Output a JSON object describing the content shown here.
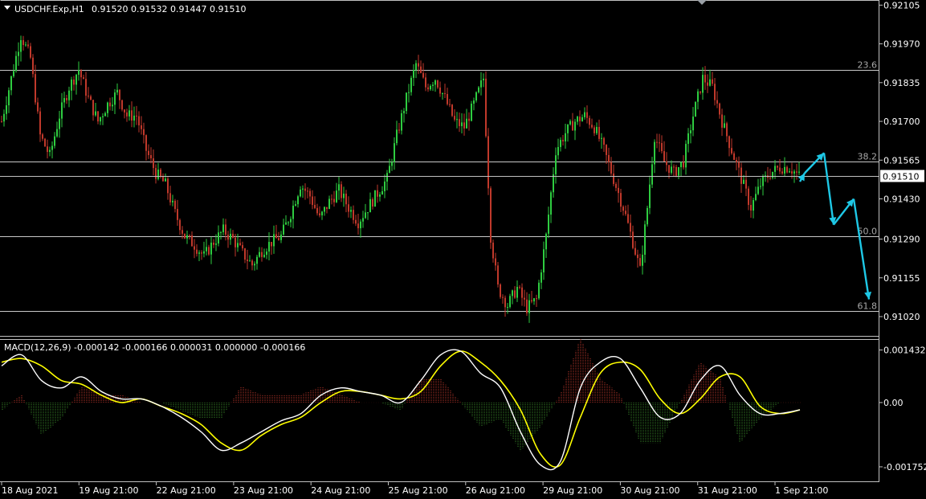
{
  "header": {
    "symbol": "USDCHF.Exp,H1",
    "ohlc": "0.91520 0.91532 0.91447 0.91510"
  },
  "colors": {
    "background": "#000000",
    "bull": "#2ecc40",
    "bear": "#c0392b",
    "grid": "#c0c0c0",
    "text": "#ffffff",
    "fib_label": "#a8a8a8",
    "signal_line": "#ffff00",
    "macd_line": "#ffffff",
    "projection": "#1ec8e6",
    "price_tag_bg": "#ffffff",
    "price_tag_text": "#000000"
  },
  "chart_data": [
    {
      "type": "candlestick",
      "title": "USDCHF.Exp,H1",
      "y_range": [
        0.9095,
        0.9212
      ],
      "y_ticks": [
        "0.92105",
        "0.91970",
        "0.91835",
        "0.91700",
        "0.91565",
        "0.91430",
        "0.91290",
        "0.91155",
        "0.91020"
      ],
      "current_price": "0.91510",
      "fibonacci_levels": [
        {
          "label": "23.6",
          "price": 0.9188
        },
        {
          "label": "38.2",
          "price": 0.9156
        },
        {
          "label": "50.0",
          "price": 0.913
        },
        {
          "label": "61.8",
          "price": 0.9104
        }
      ],
      "x_labels": [
        "18 Aug 2021",
        "19 Aug 21:00",
        "22 Aug 21:00",
        "23 Aug 21:00",
        "24 Aug 21:00",
        "25 Aug 21:00",
        "26 Aug 21:00",
        "29 Aug 21:00",
        "30 Aug 21:00",
        "31 Aug 21:00",
        "1 Sep 21:00"
      ],
      "close_path": [
        [
          0,
          0.917
        ],
        [
          4,
          0.9185
        ],
        [
          8,
          0.92
        ],
        [
          12,
          0.9192
        ],
        [
          16,
          0.9165
        ],
        [
          20,
          0.9158
        ],
        [
          24,
          0.9172
        ],
        [
          28,
          0.9182
        ],
        [
          32,
          0.9188
        ],
        [
          36,
          0.9178
        ],
        [
          40,
          0.917
        ],
        [
          44,
          0.9176
        ],
        [
          48,
          0.918
        ],
        [
          52,
          0.9172
        ],
        [
          56,
          0.9172
        ],
        [
          60,
          0.916
        ],
        [
          64,
          0.9152
        ],
        [
          68,
          0.9148
        ],
        [
          72,
          0.9138
        ],
        [
          76,
          0.913
        ],
        [
          80,
          0.9127
        ],
        [
          84,
          0.9123
        ],
        [
          88,
          0.9128
        ],
        [
          92,
          0.9132
        ],
        [
          96,
          0.9129
        ],
        [
          100,
          0.9124
        ],
        [
          104,
          0.912
        ],
        [
          108,
          0.9125
        ],
        [
          112,
          0.9128
        ],
        [
          116,
          0.913
        ],
        [
          120,
          0.9138
        ],
        [
          124,
          0.9148
        ],
        [
          128,
          0.9144
        ],
        [
          132,
          0.9136
        ],
        [
          136,
          0.9142
        ],
        [
          140,
          0.9146
        ],
        [
          144,
          0.914
        ],
        [
          148,
          0.9135
        ],
        [
          152,
          0.914
        ],
        [
          156,
          0.9145
        ],
        [
          160,
          0.915
        ],
        [
          164,
          0.9165
        ],
        [
          168,
          0.9178
        ],
        [
          172,
          0.919
        ],
        [
          176,
          0.9182
        ],
        [
          180,
          0.9185
        ],
        [
          184,
          0.9178
        ],
        [
          188,
          0.917
        ],
        [
          192,
          0.9168
        ],
        [
          196,
          0.9176
        ],
        [
          200,
          0.9185
        ],
        [
          203,
          0.913
        ],
        [
          206,
          0.9112
        ],
        [
          210,
          0.9106
        ],
        [
          214,
          0.9112
        ],
        [
          218,
          0.9105
        ],
        [
          222,
          0.9108
        ],
        [
          226,
          0.913
        ],
        [
          230,
          0.916
        ],
        [
          234,
          0.9166
        ],
        [
          238,
          0.917
        ],
        [
          242,
          0.9172
        ],
        [
          246,
          0.9168
        ],
        [
          250,
          0.916
        ],
        [
          254,
          0.915
        ],
        [
          258,
          0.914
        ],
        [
          262,
          0.9128
        ],
        [
          265,
          0.9118
        ],
        [
          268,
          0.914
        ],
        [
          271,
          0.9165
        ],
        [
          275,
          0.9156
        ],
        [
          279,
          0.9152
        ],
        [
          283,
          0.9156
        ],
        [
          287,
          0.9172
        ],
        [
          291,
          0.9185
        ],
        [
          295,
          0.9182
        ],
        [
          299,
          0.917
        ],
        [
          303,
          0.916
        ],
        [
          307,
          0.915
        ],
        [
          311,
          0.914
        ],
        [
          315,
          0.9148
        ],
        [
          319,
          0.9152
        ],
        [
          323,
          0.9154
        ],
        [
          327,
          0.9154
        ],
        [
          331,
          0.9151
        ]
      ],
      "projection": [
        0.9149,
        0.9152,
        0.9159,
        0.9134,
        0.9143,
        0.9108
      ]
    },
    {
      "type": "line",
      "title": "MACD(12,26,9) -0.000142 -0.000166 0.000031 0.000000 -0.000166",
      "y_range": [
        -0.00195,
        0.00162
      ],
      "y_ticks": [
        "0.001432",
        "0.00",
        "-0.001752"
      ],
      "series": [
        {
          "name": "MACD",
          "values": [
            0.001,
            0.0013,
            0.0006,
            0.0004,
            0.0007,
            0.0003,
            0.0001,
            0.0001,
            -0.0001,
            -0.0004,
            -0.0008,
            -0.0013,
            -0.0011,
            -0.0008,
            -0.0005,
            -0.0003,
            0.0002,
            0.0004,
            0.0003,
            0.0002,
            0.0,
            0.0006,
            0.0013,
            0.0014,
            0.0008,
            0.0004,
            -0.0008,
            -0.0017,
            -0.0016,
            0.0004,
            0.0011,
            0.0012,
            0.0004,
            -0.0004,
            -0.0003,
            0.0006,
            0.001,
            0.0002,
            -0.0003,
            -0.0003,
            -0.0002
          ]
        },
        {
          "name": "Signal",
          "values": [
            0.0011,
            0.0012,
            0.001,
            0.0006,
            0.0005,
            0.0002,
            0.0,
            0.0001,
            -0.0001,
            -0.0003,
            -0.0006,
            -0.0011,
            -0.0013,
            -0.0009,
            -0.0006,
            -0.0004,
            0.0,
            0.0003,
            0.0003,
            0.0002,
            0.0001,
            0.0003,
            0.001,
            0.0014,
            0.0011,
            0.0006,
            -0.0002,
            -0.0014,
            -0.0017,
            -0.0004,
            0.0008,
            0.0011,
            0.0009,
            0.0001,
            -0.0003,
            0.0001,
            0.0007,
            0.0007,
            -0.0001,
            -0.0003,
            -0.0002
          ]
        }
      ]
    }
  ]
}
